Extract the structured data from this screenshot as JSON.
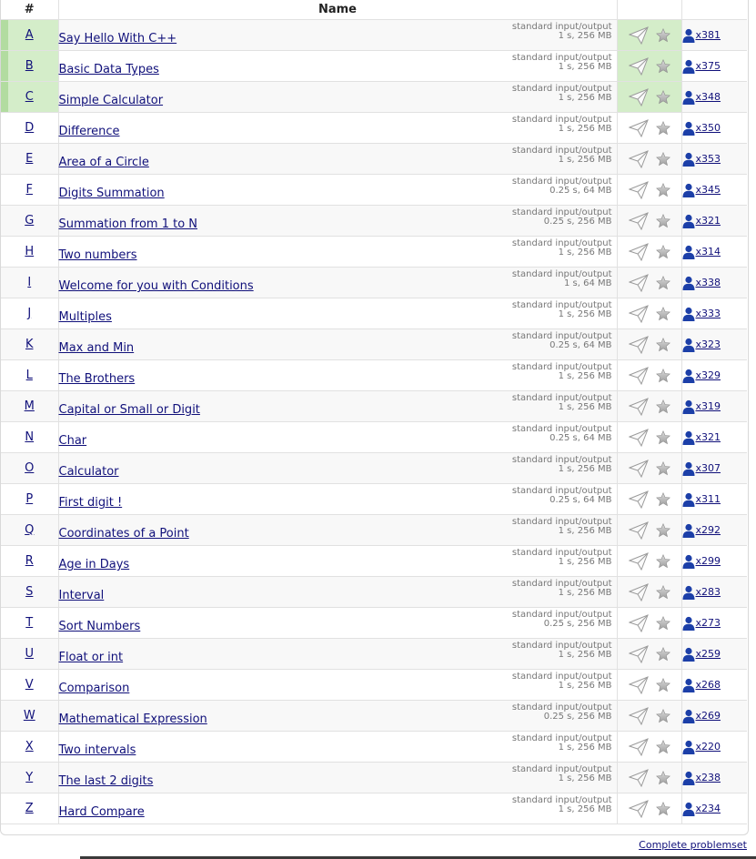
{
  "table": {
    "header": {
      "id": "#",
      "name": "Name"
    },
    "rows": [
      {
        "id": "A",
        "name": "Say Hello With C++",
        "io": "standard input/output",
        "limits": "1 s, 256 MB",
        "solved": "x381",
        "accepted": true
      },
      {
        "id": "B",
        "name": "Basic Data Types",
        "io": "standard input/output",
        "limits": "1 s, 256 MB",
        "solved": "x375",
        "accepted": true
      },
      {
        "id": "C",
        "name": "Simple Calculator",
        "io": "standard input/output",
        "limits": "1 s, 256 MB",
        "solved": "x348",
        "accepted": true
      },
      {
        "id": "D",
        "name": "Difference",
        "io": "standard input/output",
        "limits": "1 s, 256 MB",
        "solved": "x350",
        "accepted": false
      },
      {
        "id": "E",
        "name": "Area of a Circle",
        "io": "standard input/output",
        "limits": "1 s, 256 MB",
        "solved": "x353",
        "accepted": false
      },
      {
        "id": "F",
        "name": "Digits Summation",
        "io": "standard input/output",
        "limits": "0.25 s, 64 MB",
        "solved": "x345",
        "accepted": false
      },
      {
        "id": "G",
        "name": "Summation from 1 to N",
        "io": "standard input/output",
        "limits": "0.25 s, 256 MB",
        "solved": "x321",
        "accepted": false
      },
      {
        "id": "H",
        "name": "Two numbers",
        "io": "standard input/output",
        "limits": "1 s, 256 MB",
        "solved": "x314",
        "accepted": false
      },
      {
        "id": "I",
        "name": "Welcome for you with Conditions",
        "io": "standard input/output",
        "limits": "1 s, 64 MB",
        "solved": "x338",
        "accepted": false
      },
      {
        "id": "J",
        "name": "Multiples",
        "io": "standard input/output",
        "limits": "1 s, 256 MB",
        "solved": "x333",
        "accepted": false
      },
      {
        "id": "K",
        "name": "Max and Min",
        "io": "standard input/output",
        "limits": "0.25 s, 64 MB",
        "solved": "x323",
        "accepted": false
      },
      {
        "id": "L",
        "name": "The Brothers",
        "io": "standard input/output",
        "limits": "1 s, 256 MB",
        "solved": "x329",
        "accepted": false
      },
      {
        "id": "M",
        "name": "Capital or Small or Digit",
        "io": "standard input/output",
        "limits": "1 s, 256 MB",
        "solved": "x319",
        "accepted": false
      },
      {
        "id": "N",
        "name": "Char",
        "io": "standard input/output",
        "limits": "0.25 s, 64 MB",
        "solved": "x321",
        "accepted": false
      },
      {
        "id": "O",
        "name": "Calculator",
        "io": "standard input/output",
        "limits": "1 s, 256 MB",
        "solved": "x307",
        "accepted": false
      },
      {
        "id": "P",
        "name": "First digit !",
        "io": "standard input/output",
        "limits": "0.25 s, 64 MB",
        "solved": "x311",
        "accepted": false
      },
      {
        "id": "Q",
        "name": "Coordinates of a Point",
        "io": "standard input/output",
        "limits": "1 s, 256 MB",
        "solved": "x292",
        "accepted": false
      },
      {
        "id": "R",
        "name": "Age in Days",
        "io": "standard input/output",
        "limits": "1 s, 256 MB",
        "solved": "x299",
        "accepted": false
      },
      {
        "id": "S",
        "name": "Interval",
        "io": "standard input/output",
        "limits": "1 s, 256 MB",
        "solved": "x283",
        "accepted": false
      },
      {
        "id": "T",
        "name": "Sort Numbers",
        "io": "standard input/output",
        "limits": "0.25 s, 256 MB",
        "solved": "x273",
        "accepted": false
      },
      {
        "id": "U",
        "name": "Float or int",
        "io": "standard input/output",
        "limits": "1 s, 256 MB",
        "solved": "x259",
        "accepted": false
      },
      {
        "id": "V",
        "name": "Comparison",
        "io": "standard input/output",
        "limits": "1 s, 256 MB",
        "solved": "x268",
        "accepted": false
      },
      {
        "id": "W",
        "name": "Mathematical Expression",
        "io": "standard input/output",
        "limits": "0.25 s, 256 MB",
        "solved": "x269",
        "accepted": false
      },
      {
        "id": "X",
        "name": "Two intervals",
        "io": "standard input/output",
        "limits": "1 s, 256 MB",
        "solved": "x220",
        "accepted": false
      },
      {
        "id": "Y",
        "name": "The last 2 digits",
        "io": "standard input/output",
        "limits": "1 s, 256 MB",
        "solved": "x238",
        "accepted": false
      },
      {
        "id": "Z",
        "name": "Hard Compare",
        "io": "standard input/output",
        "limits": "1 s, 256 MB",
        "solved": "x234",
        "accepted": false
      }
    ]
  },
  "footer": {
    "complete_problemset": "Complete problemset"
  },
  "icons": {
    "submit": "paper-plane-icon",
    "favourite": "star-icon",
    "solved_by": "user-icon"
  },
  "colors": {
    "link": "#10107a",
    "accepted_bg": "#d4edc9",
    "accepted_stripe": "#b2dca0",
    "user_icon": "#1c3fa8"
  }
}
